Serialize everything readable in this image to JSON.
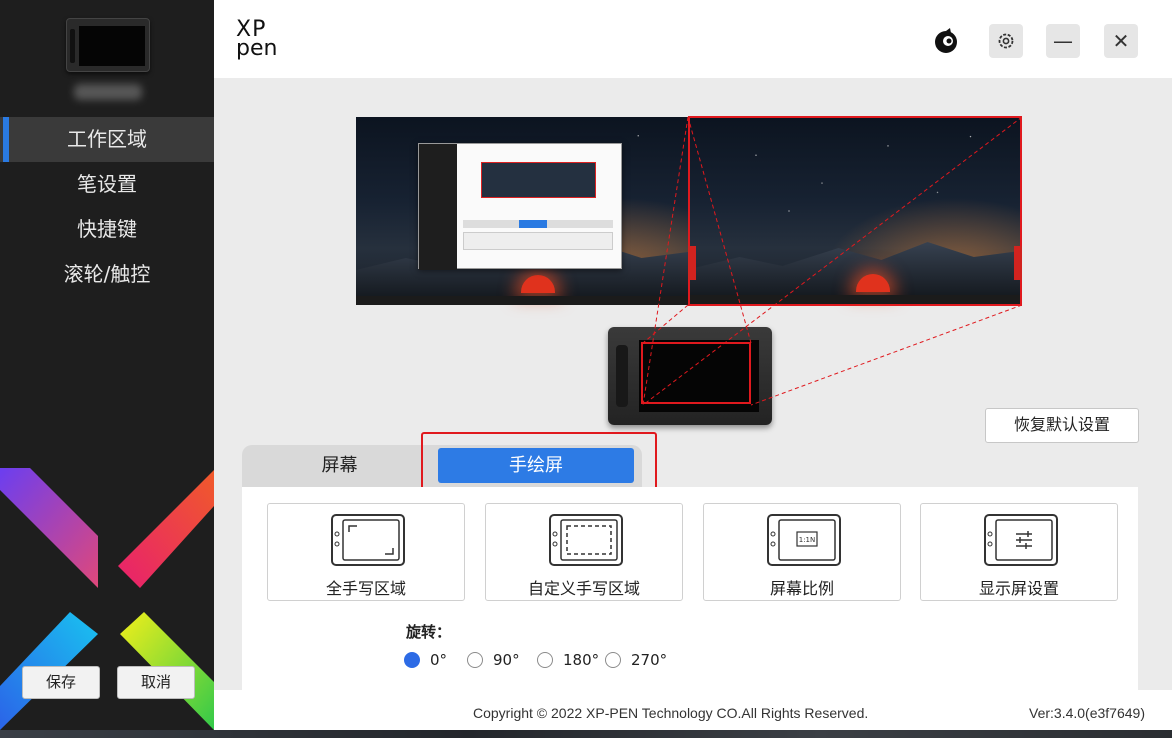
{
  "sidebar": {
    "items": [
      {
        "label": "工作区域",
        "active": true
      },
      {
        "label": "笔设置",
        "active": false
      },
      {
        "label": "快捷键",
        "active": false
      },
      {
        "label": "滚轮/触控",
        "active": false
      }
    ],
    "save_label": "保存",
    "cancel_label": "取消"
  },
  "header": {
    "brand_line1": "XP",
    "brand_line2": "pen",
    "icons": [
      "bird-icon",
      "gear-icon",
      "minimize-icon",
      "close-icon"
    ],
    "minimize_glyph": "—",
    "close_glyph": "✕"
  },
  "preview": {
    "restore_label": "恢复默认设置"
  },
  "tabs": {
    "screen_label": "屏幕",
    "tablet_label": "手绘屏",
    "active": "tablet"
  },
  "cards": [
    {
      "label": "全手写区域",
      "icon": "full-area-icon"
    },
    {
      "label": "自定义手写区域",
      "icon": "custom-area-icon"
    },
    {
      "label": "屏幕比例",
      "icon": "screen-ratio-icon",
      "badge": "1:1N"
    },
    {
      "label": "显示屏设置",
      "icon": "display-settings-icon"
    }
  ],
  "rotation": {
    "label": "旋转：",
    "options": [
      "0°",
      "90°",
      "180°",
      "270°"
    ],
    "selected": "0°"
  },
  "footer": {
    "copyright": "Copyright © 2022  XP-PEN Technology CO.All Rights Reserved.",
    "version": "Ver:3.4.0(e3f7649)"
  },
  "colors": {
    "accent": "#2d7be5",
    "highlight": "#e0191e",
    "sidebar_bg": "#1e1e1e"
  }
}
